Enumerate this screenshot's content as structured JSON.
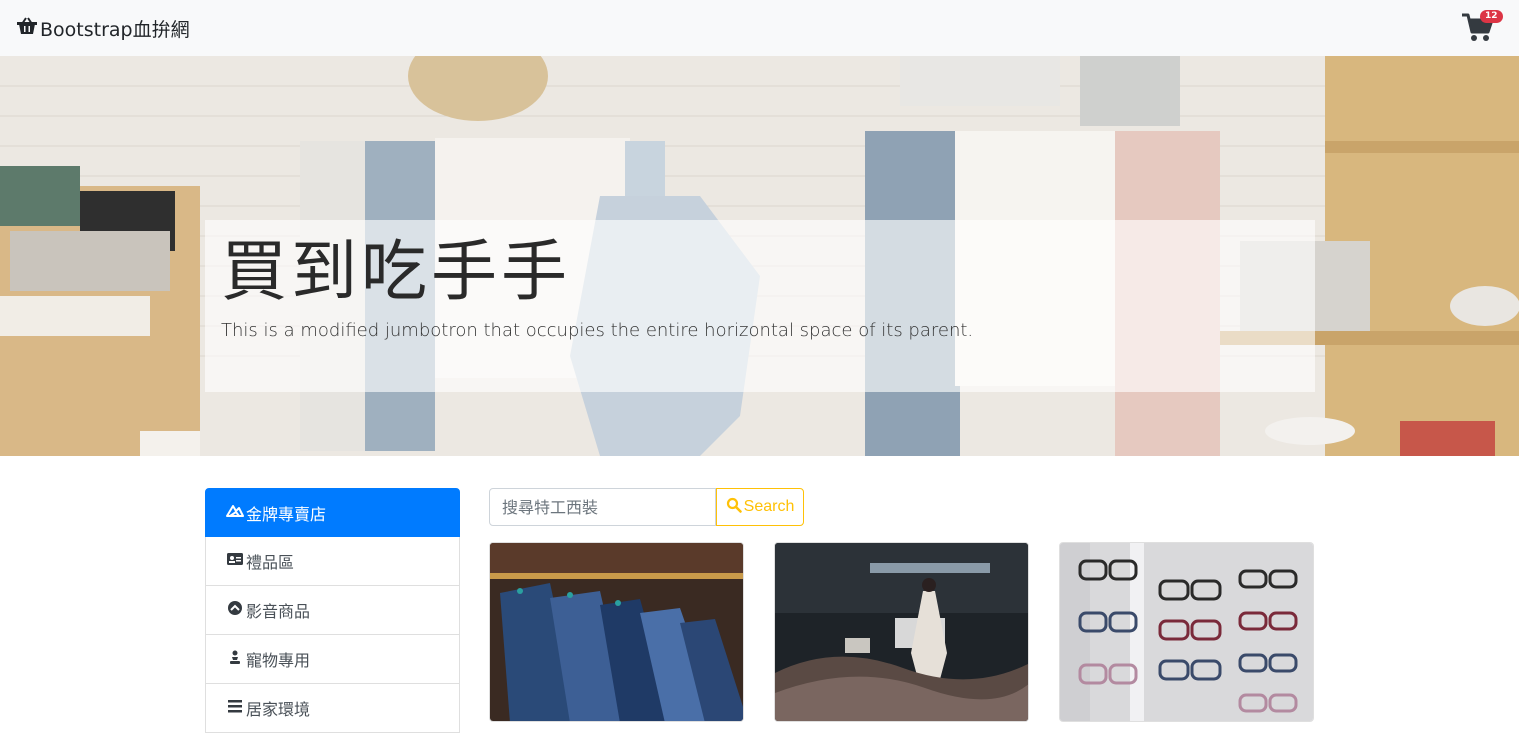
{
  "navbar": {
    "brand_label": "Bootstrap血拚網",
    "brand_icon": "shopping-basket-icon",
    "cart_icon": "shopping-cart-icon",
    "cart_count": "12"
  },
  "jumbotron": {
    "title": "買到吃手手",
    "lead": "This is a modified jumbotron that occupies the entire horizontal space of its parent."
  },
  "sidebar": {
    "items": [
      {
        "label": "金牌專賣店",
        "icon": "brand-icon",
        "active": true
      },
      {
        "label": "禮品區",
        "icon": "id-card-icon",
        "active": false
      },
      {
        "label": "影音商品",
        "icon": "chevron-circle-up-icon",
        "active": false
      },
      {
        "label": "寵物專用",
        "icon": "chess-pawn-icon",
        "active": false
      },
      {
        "label": "居家環境",
        "icon": "bars-icon",
        "active": false
      }
    ]
  },
  "search": {
    "placeholder": "搜尋特工西裝",
    "button_label": "Search",
    "button_icon": "search-icon"
  },
  "products": [
    {
      "image": "clothing-rack-photo"
    },
    {
      "image": "tiffany-store-window-photo"
    },
    {
      "image": "eyeglasses-display-photo"
    }
  ],
  "colors": {
    "primary": "#007bff",
    "warning": "#ffc107",
    "danger": "#dc3545",
    "navbar_bg": "#f8f9fa"
  }
}
